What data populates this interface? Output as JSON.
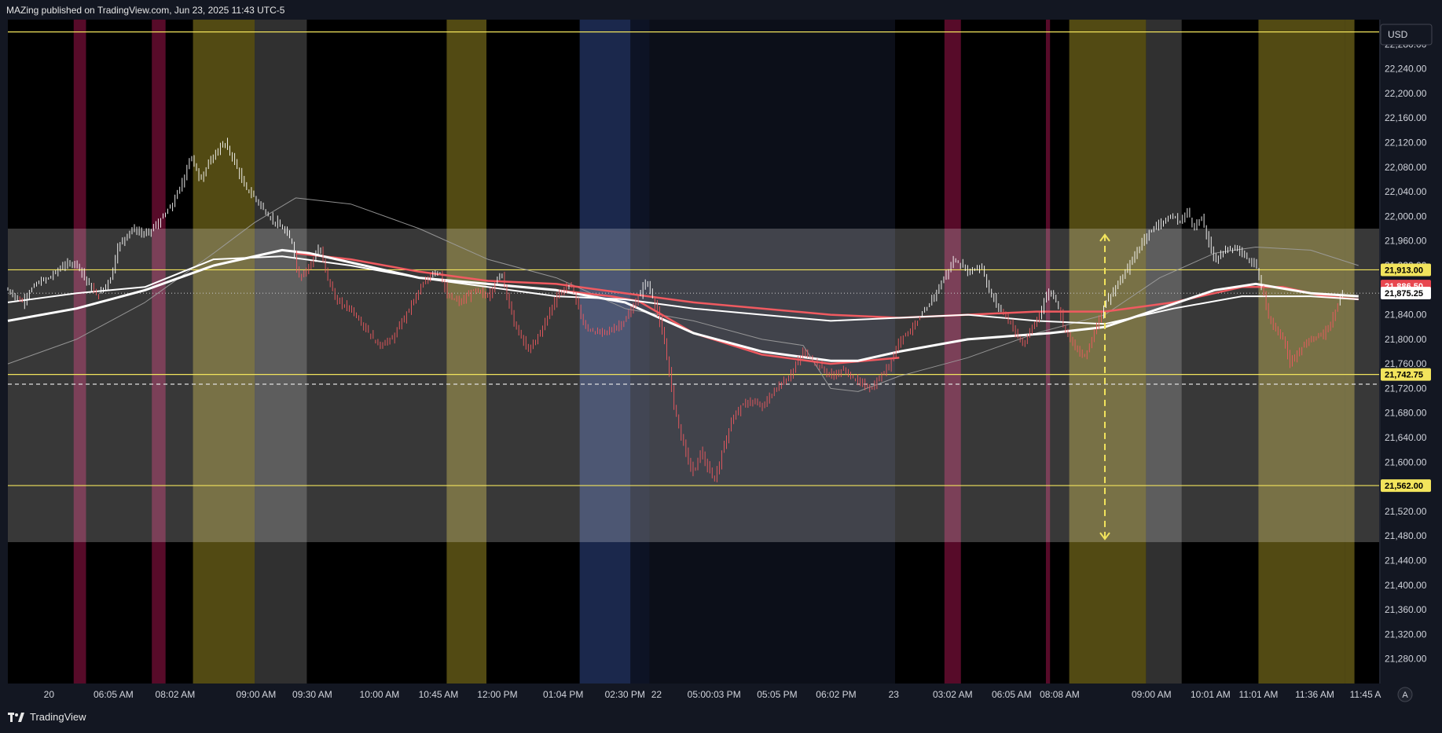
{
  "header": {
    "title": "MAZing published on TradingView.com, Jun 23, 2025 11:43 UTC-5"
  },
  "footer": {
    "brand": "TradingView"
  },
  "currency_button": "USD",
  "auto_scale": "A",
  "chart_data": {
    "type": "candlestick",
    "title": "",
    "ylim": [
      21240,
      22320
    ],
    "y_ticks": [
      22280,
      22240,
      22200,
      22160,
      22120,
      22080,
      22040,
      22000,
      21960,
      21920,
      21880,
      21840,
      21800,
      21760,
      21720,
      21680,
      21640,
      21600,
      21560,
      21520,
      21480,
      21440,
      21400,
      21360,
      21320,
      21280
    ],
    "y_tick_labels": [
      "22,280.00",
      "22,240.00",
      "22,200.00",
      "22,160.00",
      "22,120.00",
      "22,080.00",
      "22,040.00",
      "22,000.00",
      "21,960.00",
      "21,920.00",
      "21,880.00",
      "21,840.00",
      "21,800.00",
      "21,760.00",
      "21,720.00",
      "21,680.00",
      "21,640.00",
      "21,600.00",
      "21,560.00",
      "21,520.00",
      "21,480.00",
      "21,440.00",
      "21,400.00",
      "21,360.00",
      "21,320.00",
      "21,280.00"
    ],
    "x_ticks": [
      {
        "label": "20",
        "t": 0.03
      },
      {
        "label": "06:05 AM",
        "t": 0.077
      },
      {
        "label": "08:02 AM",
        "t": 0.122
      },
      {
        "label": "09:00 AM",
        "t": 0.181
      },
      {
        "label": "09:30 AM",
        "t": 0.222
      },
      {
        "label": "10:00 AM",
        "t": 0.271
      },
      {
        "label": "10:45 AM",
        "t": 0.314
      },
      {
        "label": "12:00 PM",
        "t": 0.357
      },
      {
        "label": "01:04 PM",
        "t": 0.405
      },
      {
        "label": "02:30 PM",
        "t": 0.45
      },
      {
        "label": "22",
        "t": 0.473
      },
      {
        "label": "05:00:03 PM",
        "t": 0.515
      },
      {
        "label": "05:05 PM",
        "t": 0.561
      },
      {
        "label": "06:02 PM",
        "t": 0.604
      },
      {
        "label": "23",
        "t": 0.646
      },
      {
        "label": "03:02 AM",
        "t": 0.689
      },
      {
        "label": "06:05 AM",
        "t": 0.732
      },
      {
        "label": "08:08 AM",
        "t": 0.767
      },
      {
        "label": "09:00 AM",
        "t": 0.834
      },
      {
        "label": "10:01 AM",
        "t": 0.877
      },
      {
        "label": "11:01 AM",
        "t": 0.912
      },
      {
        "label": "11:36 AM",
        "t": 0.953
      },
      {
        "label": "11:45 A",
        "t": 0.99
      }
    ],
    "horizontal_levels": [
      {
        "value": 22300,
        "color": "#f2e45c",
        "style": "solid",
        "label": ""
      },
      {
        "value": 21913.0,
        "color": "#f2e45c",
        "style": "solid",
        "label": "21,913.00"
      },
      {
        "value": 21742.75,
        "color": "#f2e45c",
        "style": "solid",
        "label": "21,742.75"
      },
      {
        "value": 21562.0,
        "color": "#f2e45c",
        "style": "solid",
        "label": "21,562.00"
      },
      {
        "value": 21727,
        "color": "#e0e0e0",
        "style": "dashed",
        "label": ""
      },
      {
        "value": 21875,
        "color": "#bdbdbd",
        "style": "dotted",
        "label": ""
      }
    ],
    "price_labels": [
      {
        "value": 21913.0,
        "text": "21,913.00",
        "bg": "#f2e45c",
        "fg": "#000000"
      },
      {
        "value": 21886.5,
        "text": "21,886.50",
        "bg": "#e8474f",
        "fg": "#ffffff"
      },
      {
        "value": 21875.25,
        "text": "21,875.25",
        "bg": "#ffffff",
        "fg": "#000000"
      },
      {
        "value": 21742.75,
        "text": "21,742.75",
        "bg": "#f2e45c",
        "fg": "#000000"
      },
      {
        "value": 21562.0,
        "text": "21,562.00",
        "bg": "#f2e45c",
        "fg": "#000000"
      }
    ],
    "range_box": {
      "top": 21980,
      "bottom": 21470,
      "color": "#ffffff",
      "opacity": 0.22
    },
    "vertical_bands": [
      {
        "t0": 0.048,
        "t1": 0.057,
        "color": "#c2185b"
      },
      {
        "t0": 0.105,
        "t1": 0.115,
        "color": "#c2185b"
      },
      {
        "t0": 0.135,
        "t1": 0.18,
        "color": "#b5a32a"
      },
      {
        "t0": 0.18,
        "t1": 0.218,
        "color": "#6b6b6b"
      },
      {
        "t0": 0.32,
        "t1": 0.349,
        "color": "#b5a32a"
      },
      {
        "t0": 0.417,
        "t1": 0.454,
        "color": "#3b58a8"
      },
      {
        "t0": 0.454,
        "t1": 0.468,
        "color": "#1d2b53"
      },
      {
        "t0": 0.468,
        "t1": 0.647,
        "color": "#1a2238"
      },
      {
        "t0": 0.683,
        "t1": 0.695,
        "color": "#c2185b"
      },
      {
        "t0": 0.757,
        "t1": 0.76,
        "color": "#c2185b"
      },
      {
        "t0": 0.774,
        "t1": 0.83,
        "color": "#b5a32a"
      },
      {
        "t0": 0.83,
        "t1": 0.856,
        "color": "#6b6b6b"
      },
      {
        "t0": 0.912,
        "t1": 0.975,
        "color": "#b5a32a"
      },
      {
        "t0": 0.975,
        "t1": 0.982,
        "color": "#b5a32a"
      }
    ],
    "price_path": [
      [
        0.0,
        21880
      ],
      [
        0.01,
        21860
      ],
      [
        0.02,
        21890
      ],
      [
        0.03,
        21900
      ],
      [
        0.04,
        21920
      ],
      [
        0.05,
        21925
      ],
      [
        0.057,
        21895
      ],
      [
        0.065,
        21870
      ],
      [
        0.075,
        21900
      ],
      [
        0.08,
        21950
      ],
      [
        0.09,
        21980
      ],
      [
        0.1,
        21970
      ],
      [
        0.11,
        21990
      ],
      [
        0.12,
        22020
      ],
      [
        0.128,
        22060
      ],
      [
        0.133,
        22100
      ],
      [
        0.14,
        22060
      ],
      [
        0.15,
        22100
      ],
      [
        0.158,
        22120
      ],
      [
        0.165,
        22090
      ],
      [
        0.172,
        22050
      ],
      [
        0.18,
        22030
      ],
      [
        0.19,
        22000
      ],
      [
        0.2,
        21980
      ],
      [
        0.207,
        21960
      ],
      [
        0.212,
        21900
      ],
      [
        0.22,
        21920
      ],
      [
        0.227,
        21950
      ],
      [
        0.233,
        21900
      ],
      [
        0.24,
        21860
      ],
      [
        0.25,
        21850
      ],
      [
        0.26,
        21820
      ],
      [
        0.27,
        21790
      ],
      [
        0.28,
        21800
      ],
      [
        0.29,
        21840
      ],
      [
        0.3,
        21880
      ],
      [
        0.31,
        21910
      ],
      [
        0.315,
        21910
      ],
      [
        0.32,
        21870
      ],
      [
        0.33,
        21860
      ],
      [
        0.34,
        21880
      ],
      [
        0.35,
        21870
      ],
      [
        0.36,
        21910
      ],
      [
        0.365,
        21860
      ],
      [
        0.37,
        21820
      ],
      [
        0.38,
        21780
      ],
      [
        0.39,
        21820
      ],
      [
        0.4,
        21870
      ],
      [
        0.41,
        21890
      ],
      [
        0.415,
        21860
      ],
      [
        0.42,
        21820
      ],
      [
        0.43,
        21810
      ],
      [
        0.44,
        21815
      ],
      [
        0.45,
        21830
      ],
      [
        0.46,
        21870
      ],
      [
        0.465,
        21895
      ],
      [
        0.47,
        21870
      ],
      [
        0.475,
        21830
      ],
      [
        0.48,
        21780
      ],
      [
        0.485,
        21700
      ],
      [
        0.49,
        21650
      ],
      [
        0.495,
        21610
      ],
      [
        0.5,
        21580
      ],
      [
        0.505,
        21620
      ],
      [
        0.51,
        21590
      ],
      [
        0.515,
        21570
      ],
      [
        0.52,
        21610
      ],
      [
        0.525,
        21650
      ],
      [
        0.53,
        21680
      ],
      [
        0.54,
        21700
      ],
      [
        0.55,
        21690
      ],
      [
        0.56,
        21720
      ],
      [
        0.57,
        21740
      ],
      [
        0.58,
        21780
      ],
      [
        0.59,
        21760
      ],
      [
        0.6,
        21740
      ],
      [
        0.61,
        21750
      ],
      [
        0.62,
        21730
      ],
      [
        0.63,
        21720
      ],
      [
        0.64,
        21750
      ],
      [
        0.645,
        21770
      ],
      [
        0.65,
        21800
      ],
      [
        0.66,
        21820
      ],
      [
        0.67,
        21850
      ],
      [
        0.675,
        21870
      ],
      [
        0.68,
        21890
      ],
      [
        0.69,
        21930
      ],
      [
        0.695,
        21920
      ],
      [
        0.7,
        21910
      ],
      [
        0.71,
        21920
      ],
      [
        0.715,
        21880
      ],
      [
        0.72,
        21860
      ],
      [
        0.73,
        21830
      ],
      [
        0.735,
        21810
      ],
      [
        0.74,
        21790
      ],
      [
        0.75,
        21830
      ],
      [
        0.755,
        21860
      ],
      [
        0.76,
        21880
      ],
      [
        0.765,
        21860
      ],
      [
        0.77,
        21820
      ],
      [
        0.775,
        21800
      ],
      [
        0.78,
        21780
      ],
      [
        0.785,
        21770
      ],
      [
        0.79,
        21800
      ],
      [
        0.8,
        21860
      ],
      [
        0.81,
        21890
      ],
      [
        0.82,
        21930
      ],
      [
        0.83,
        21970
      ],
      [
        0.84,
        21990
      ],
      [
        0.85,
        22000
      ],
      [
        0.855,
        21990
      ],
      [
        0.86,
        22010
      ],
      [
        0.865,
        21980
      ],
      [
        0.87,
        22000
      ],
      [
        0.875,
        21960
      ],
      [
        0.88,
        21930
      ],
      [
        0.89,
        21950
      ],
      [
        0.9,
        21940
      ],
      [
        0.91,
        21920
      ],
      [
        0.915,
        21880
      ],
      [
        0.92,
        21830
      ],
      [
        0.93,
        21800
      ],
      [
        0.935,
        21760
      ],
      [
        0.94,
        21780
      ],
      [
        0.95,
        21800
      ],
      [
        0.96,
        21810
      ],
      [
        0.965,
        21830
      ],
      [
        0.97,
        21860
      ],
      [
        0.975,
        21890
      ]
    ],
    "ma_white": [
      [
        0.0,
        21860
      ],
      [
        0.05,
        21875
      ],
      [
        0.1,
        21885
      ],
      [
        0.15,
        21930
      ],
      [
        0.2,
        21935
      ],
      [
        0.25,
        21920
      ],
      [
        0.3,
        21900
      ],
      [
        0.35,
        21885
      ],
      [
        0.4,
        21870
      ],
      [
        0.45,
        21865
      ],
      [
        0.5,
        21850
      ],
      [
        0.55,
        21840
      ],
      [
        0.6,
        21830
      ],
      [
        0.65,
        21835
      ],
      [
        0.7,
        21840
      ],
      [
        0.75,
        21830
      ],
      [
        0.8,
        21825
      ],
      [
        0.85,
        21850
      ],
      [
        0.9,
        21870
      ],
      [
        0.95,
        21870
      ],
      [
        0.985,
        21865
      ]
    ],
    "ma_white_fast": [
      [
        0.0,
        21830
      ],
      [
        0.05,
        21850
      ],
      [
        0.1,
        21880
      ],
      [
        0.15,
        21920
      ],
      [
        0.2,
        21945
      ],
      [
        0.22,
        21940
      ],
      [
        0.26,
        21920
      ],
      [
        0.3,
        21900
      ],
      [
        0.35,
        21890
      ],
      [
        0.4,
        21880
      ],
      [
        0.45,
        21860
      ],
      [
        0.5,
        21810
      ],
      [
        0.55,
        21780
      ],
      [
        0.6,
        21765
      ],
      [
        0.62,
        21765
      ],
      [
        0.65,
        21780
      ],
      [
        0.7,
        21800
      ],
      [
        0.73,
        21805
      ],
      [
        0.76,
        21810
      ],
      [
        0.8,
        21820
      ],
      [
        0.84,
        21850
      ],
      [
        0.88,
        21880
      ],
      [
        0.91,
        21890
      ],
      [
        0.95,
        21875
      ],
      [
        0.985,
        21870
      ]
    ],
    "ma_red": [
      [
        0.21,
        21940
      ],
      [
        0.25,
        21930
      ],
      [
        0.3,
        21910
      ],
      [
        0.35,
        21895
      ],
      [
        0.4,
        21890
      ],
      [
        0.45,
        21875
      ],
      [
        0.5,
        21860
      ],
      [
        0.55,
        21850
      ],
      [
        0.6,
        21840
      ],
      [
        0.65,
        21835
      ],
      [
        0.7,
        21840
      ],
      [
        0.75,
        21845
      ],
      [
        0.8,
        21845
      ],
      [
        0.85,
        21860
      ],
      [
        0.9,
        21885
      ],
      [
        0.93,
        21885
      ],
      [
        0.96,
        21870
      ],
      [
        0.985,
        21865
      ]
    ],
    "ma_red_fast": [
      [
        0.4,
        21880
      ],
      [
        0.44,
        21870
      ],
      [
        0.46,
        21862
      ],
      [
        0.5,
        21810
      ],
      [
        0.55,
        21775
      ],
      [
        0.6,
        21760
      ],
      [
        0.65,
        21770
      ]
    ],
    "ma_gray": [
      [
        0.0,
        21760
      ],
      [
        0.05,
        21800
      ],
      [
        0.1,
        21860
      ],
      [
        0.15,
        21940
      ],
      [
        0.18,
        21990
      ],
      [
        0.21,
        22030
      ],
      [
        0.25,
        22020
      ],
      [
        0.3,
        21980
      ],
      [
        0.35,
        21930
      ],
      [
        0.4,
        21900
      ],
      [
        0.45,
        21850
      ],
      [
        0.5,
        21830
      ],
      [
        0.55,
        21800
      ],
      [
        0.58,
        21790
      ],
      [
        0.6,
        21720
      ],
      [
        0.62,
        21715
      ],
      [
        0.65,
        21740
      ],
      [
        0.7,
        21770
      ],
      [
        0.75,
        21810
      ],
      [
        0.8,
        21840
      ],
      [
        0.84,
        21900
      ],
      [
        0.88,
        21940
      ],
      [
        0.91,
        21950
      ],
      [
        0.95,
        21945
      ],
      [
        0.985,
        21920
      ]
    ],
    "measure_arrow": {
      "t": 0.8,
      "top": 21970,
      "bottom": 21475,
      "color": "#f2e45c"
    }
  }
}
